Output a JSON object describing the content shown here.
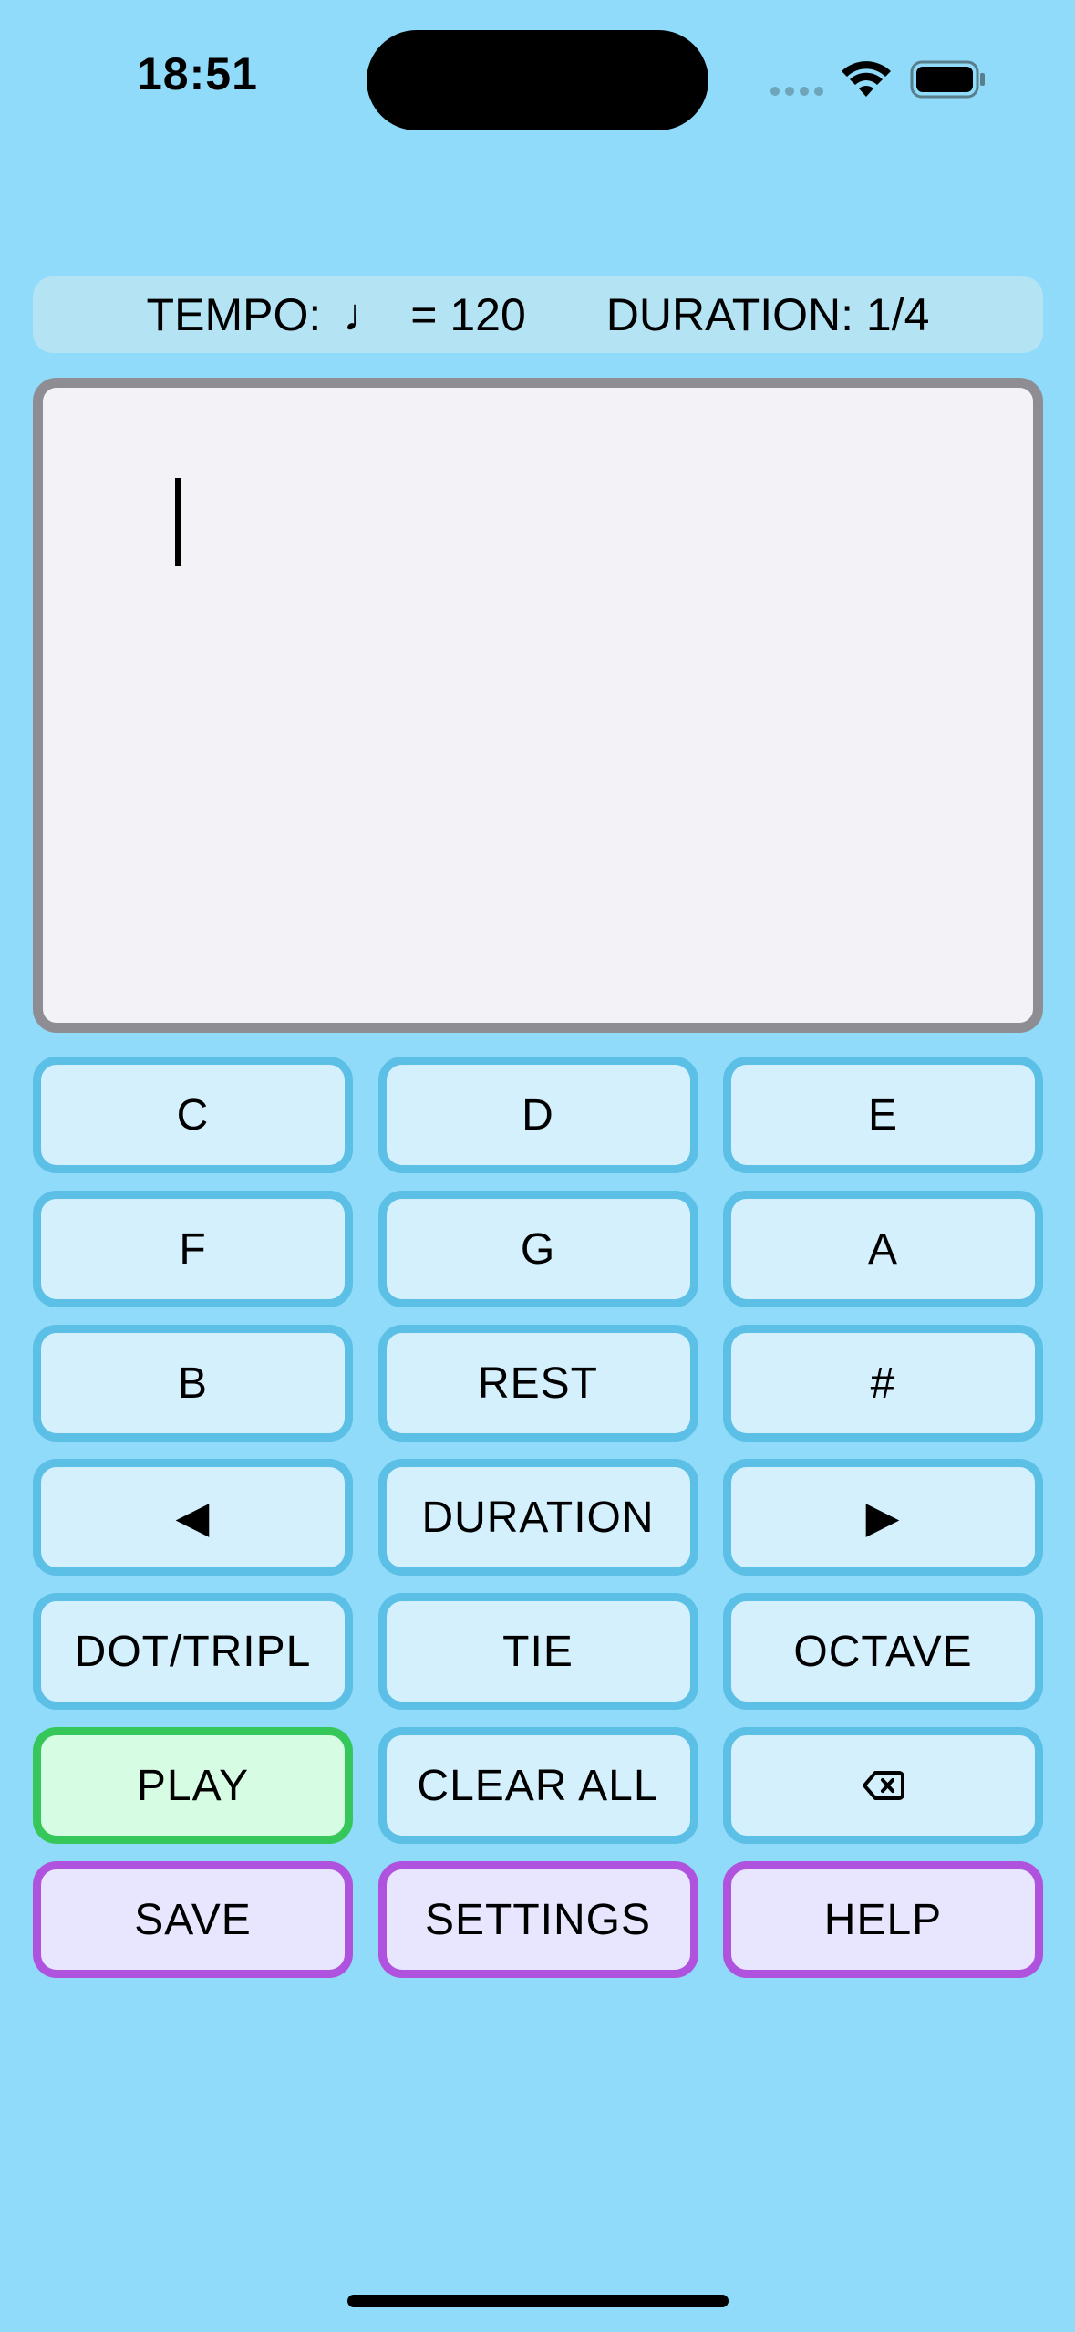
{
  "status_bar": {
    "time": "18:51",
    "icons": [
      "cellular-signal-icon",
      "wifi-icon",
      "battery-icon"
    ]
  },
  "info_bar": {
    "tempo_label": "TEMPO:",
    "note_symbol": "♩",
    "tempo_value": "= 120",
    "duration_label": "DURATION: 1/4"
  },
  "editor": {
    "content": ""
  },
  "keypad": {
    "row1": [
      "C",
      "D",
      "E"
    ],
    "row2": [
      "F",
      "G",
      "A"
    ],
    "row3": [
      "B",
      "REST",
      "#"
    ],
    "row4": {
      "left_symbol": "◀",
      "middle": "DURATION",
      "right_symbol": "▶"
    },
    "row5": [
      "DOT/TRIPL",
      "TIE",
      "OCTAVE"
    ],
    "row6": {
      "play": "PLAY",
      "clear": "CLEAR ALL",
      "backspace_icon": "delete-backward-icon"
    },
    "row7": [
      "SAVE",
      "SETTINGS",
      "HELP"
    ]
  },
  "colors": {
    "background": "#8fdbf9",
    "key_border": "#5bbfe6",
    "key_fill": "#d4f0fd",
    "play_border": "#35c759",
    "play_fill": "#d6fde4",
    "action_border": "#af52de",
    "action_fill": "#e7e6fe",
    "editor_border": "#8e8d93",
    "editor_fill": "#f3f2f7"
  }
}
